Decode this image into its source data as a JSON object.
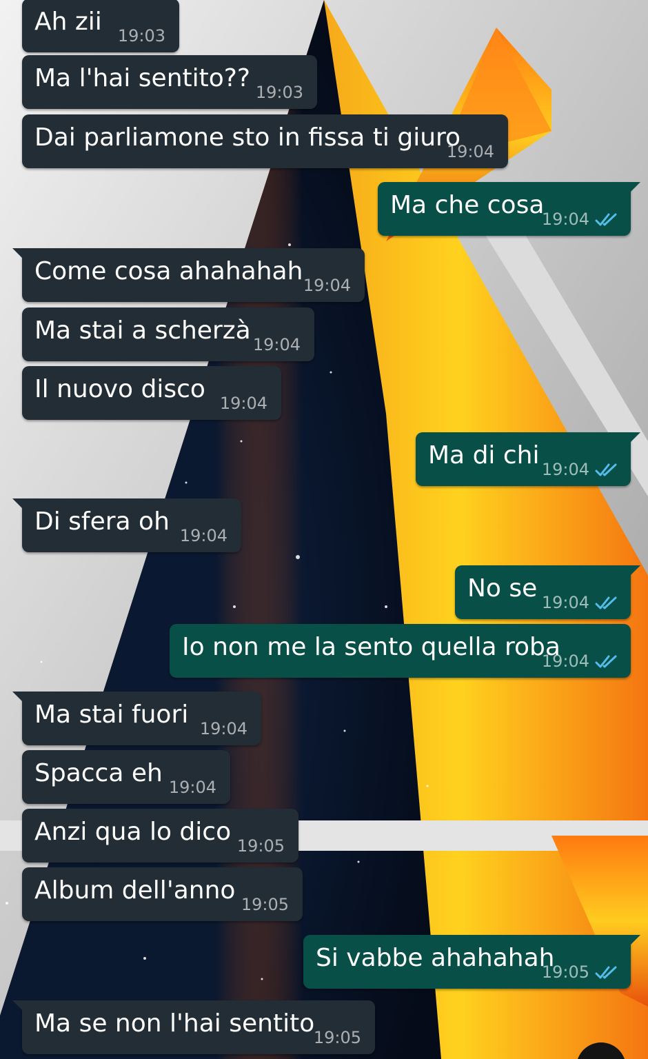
{
  "messages": [
    {
      "dir": "in",
      "text": "Ah zii",
      "time": "19:03"
    },
    {
      "dir": "in",
      "text": "Ma l'hai sentito??",
      "time": "19:03"
    },
    {
      "dir": "in",
      "text": "Dai parliamone sto in fissa ti giuro",
      "time": "19:04"
    },
    {
      "dir": "out",
      "text": "Ma che cosa",
      "time": "19:04",
      "status": "read"
    },
    {
      "dir": "in",
      "text": "Come cosa ahahahah",
      "time": "19:04"
    },
    {
      "dir": "in",
      "text": "Ma stai a scherzà",
      "time": "19:04"
    },
    {
      "dir": "in",
      "text": "Il nuovo disco",
      "time": "19:04"
    },
    {
      "dir": "out",
      "text": "Ma di chi",
      "time": "19:04",
      "status": "read"
    },
    {
      "dir": "in",
      "text": "Di sfera oh",
      "time": "19:04"
    },
    {
      "dir": "out",
      "text": "No se",
      "time": "19:04",
      "status": "read"
    },
    {
      "dir": "out",
      "text": "Io non me la sento quella roba",
      "time": "19:04",
      "status": "read"
    },
    {
      "dir": "in",
      "text": "Ma stai fuori",
      "time": "19:04"
    },
    {
      "dir": "in",
      "text": "Spacca eh",
      "time": "19:04"
    },
    {
      "dir": "in",
      "text": "Anzi qua lo dico",
      "time": "19:05"
    },
    {
      "dir": "in",
      "text": "Album dell'anno",
      "time": "19:05"
    },
    {
      "dir": "out",
      "text": "Si vabbe ahahahah",
      "time": "19:05",
      "status": "read"
    },
    {
      "dir": "in",
      "text": "Ma se non l'hai sentito",
      "time": "19:05"
    }
  ],
  "colors": {
    "incoming_bubble": "#232d36",
    "outgoing_bubble": "#074f47",
    "read_ticks": "#53bdeb"
  },
  "icons": {
    "read_receipt": "double-check-icon"
  }
}
